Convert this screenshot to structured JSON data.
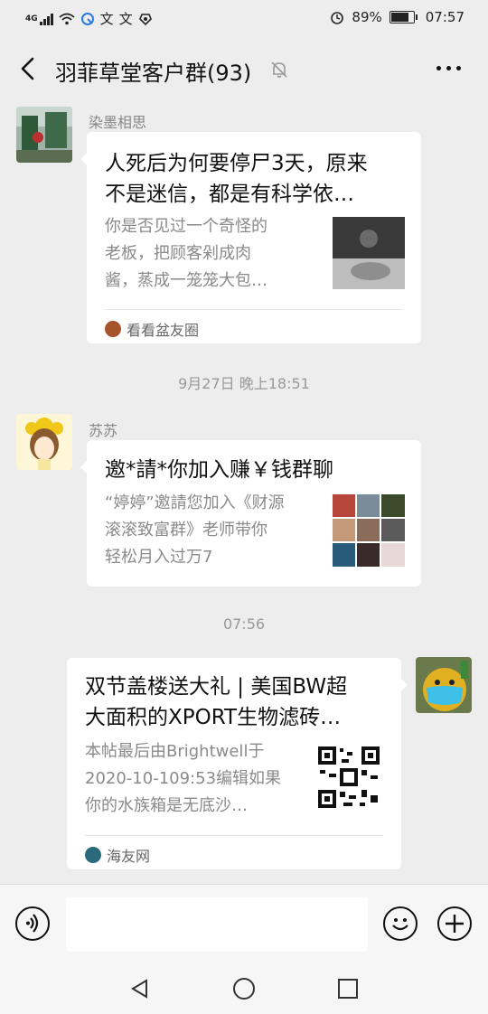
{
  "status_bar": {
    "network": "4G",
    "battery_percent": "89%",
    "battery_level": 0.89,
    "time": "07:57",
    "app_icons": [
      "weather-icon",
      "wenwen-icon",
      "wenwen-icon",
      "hand-icon"
    ]
  },
  "header": {
    "title": "羽菲草堂客户群(93)"
  },
  "messages": [
    {
      "sender": "染墨相思",
      "title_line1": "人死后为何要停尸3天，原来",
      "title_line2": "不是迷信，都是有科学依…",
      "desc_line1": "你是否见过一个奇怪的",
      "desc_line2": "老板，把顾客剁成肉",
      "desc_line3": "酱，蒸成一笼笼大包…",
      "source": "看看盆友圈"
    },
    {
      "sender": "苏苏",
      "title_line1": "邀*請*你加入赚￥钱群聊",
      "desc_line1": "“婷婷”邀請您加入《财源",
      "desc_line2": "滚滚致富群》老师带你",
      "desc_line3": "轻松月入过万7"
    },
    {
      "title_line1": "双节盖楼送大礼 | 美国BW超",
      "title_line2": "大面积的XPORT生物滤砖…",
      "desc_line1": "本帖最后由Brightwell于",
      "desc_line2": "2020-10-109:53编辑如果",
      "desc_line3": "你的水族箱是无底沙…",
      "source": "海友网"
    }
  ],
  "timestamps": [
    "9月27日 晚上18:51",
    "07:56"
  ],
  "colors": {
    "background": "#ededed",
    "card": "#ffffff",
    "muted_text": "#8a8a8a"
  }
}
